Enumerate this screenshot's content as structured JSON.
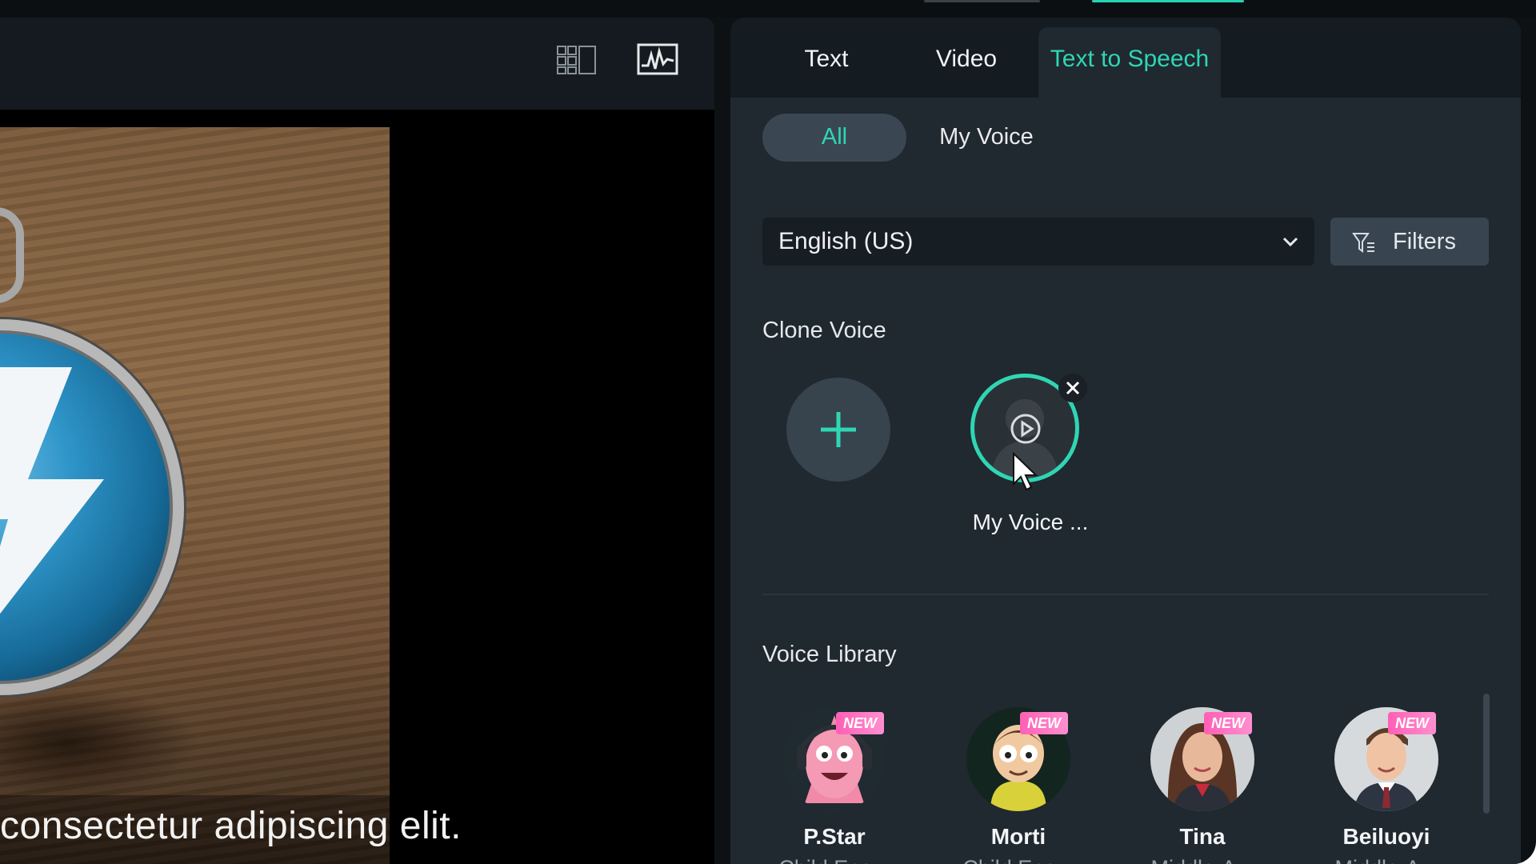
{
  "preview": {
    "caption": "consectetur adipiscing elit.",
    "toolbar": {
      "grid_icon": "grid-layout-icon",
      "waveform_icon": "waveform-icon"
    }
  },
  "tabs": [
    {
      "label": "Text",
      "active": false
    },
    {
      "label": "Video",
      "active": false
    },
    {
      "label": "Text to Speech",
      "active": true
    }
  ],
  "voice_filter": {
    "all_label": "All",
    "my_voice_label": "My Voice",
    "selected": "All"
  },
  "language": {
    "value": "English (US)"
  },
  "filters_label": "Filters",
  "clone_voice": {
    "title": "Clone Voice",
    "items": [
      {
        "name": "My Voice ..."
      }
    ]
  },
  "voice_library": {
    "title": "Voice Library",
    "badge": "NEW",
    "voices": [
      {
        "name": "P.Star",
        "desc": "Child Ene..."
      },
      {
        "name": "Morti",
        "desc": "Child Ene..."
      },
      {
        "name": "Tina",
        "desc": "Middle-A..."
      },
      {
        "name": "Beiluoyi",
        "desc": "Middle-A..."
      }
    ]
  },
  "colors": {
    "accent": "#2fd6b4",
    "panel": "#202830",
    "badge": "#ff6fbf"
  }
}
